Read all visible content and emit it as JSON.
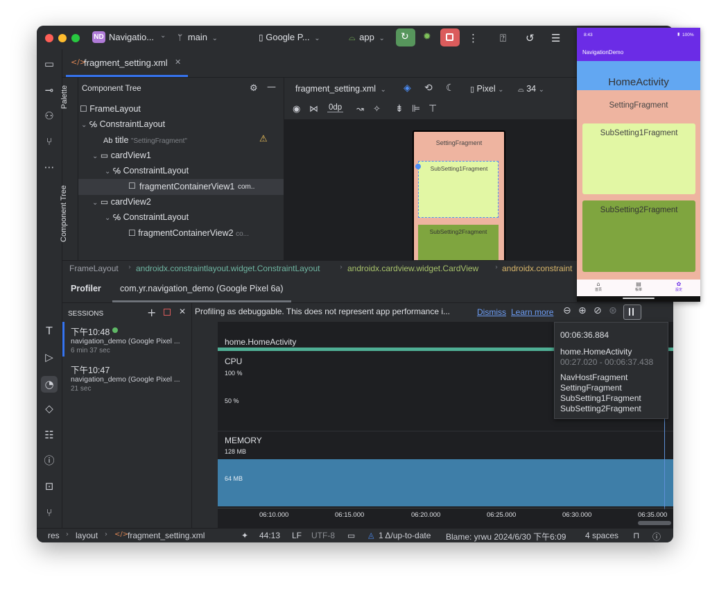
{
  "titlebar": {
    "project_badge": "ND",
    "project_name": "Navigatio...",
    "branch": "main",
    "device": "Google P...",
    "run_config": "app"
  },
  "editor_tab": {
    "label": "fragment_setting.xml"
  },
  "component_tree": {
    "title": "Component Tree",
    "palette_label": "Palette",
    "side_label": "Component Tree",
    "rows": [
      {
        "label": "FrameLayout",
        "suffix": ""
      },
      {
        "label": "ConstraintLayout",
        "suffix": ""
      },
      {
        "label": "title",
        "suffix": "\"SettingFragment\""
      },
      {
        "label": "cardView1",
        "suffix": ""
      },
      {
        "label": "ConstraintLayout",
        "suffix": ""
      },
      {
        "label": "fragmentContainerView1",
        "suffix": "com.."
      },
      {
        "label": "cardView2",
        "suffix": ""
      },
      {
        "label": "ConstraintLayout",
        "suffix": ""
      },
      {
        "label": "fragmentContainerView2",
        "suffix": "co..."
      }
    ],
    "ab_prefix": "Ab"
  },
  "design_toolbar": {
    "file": "fragment_setting.xml",
    "device": "Pixel",
    "api": "34",
    "margin": "0dp"
  },
  "preview": {
    "setting": "SettingFragment",
    "sub1": "SubSetting1Fragment",
    "sub2": "SubSetting2Fragment"
  },
  "breadcrumbs": [
    "FrameLayout",
    "androidx.constraintlayout.widget.ConstraintLayout",
    "androidx.cardview.widget.CardView",
    "androidx.constraint"
  ],
  "profiler": {
    "title": "Profiler",
    "process_tab": "com.yr.navigation_demo (Google Pixel 6a)",
    "sessions_label": "SESSIONS",
    "banner": "Profiling as debuggable. This does not represent app performance i...",
    "dismiss": "Dismiss",
    "learn_more": "Learn more",
    "sessions": [
      {
        "time": "下午10:48",
        "name": "navigation_demo (Google Pixel ...",
        "duration": "6 min 37 sec"
      },
      {
        "time": "下午10:47",
        "name": "navigation_demo (Google Pixel ...",
        "duration": "21 sec"
      }
    ],
    "activity_label": "home.HomeActivity",
    "cpu_label": "CPU",
    "cpu_ticks": [
      "100 %",
      "50 %"
    ],
    "memory_label": "MEMORY",
    "memory_ticks": [
      "128 MB",
      "64 MB"
    ],
    "time_ticks": [
      "06:10.000",
      "06:15.000",
      "06:20.000",
      "06:25.000",
      "06:30.000",
      "06:35.000"
    ],
    "tooltip": {
      "time": "00:06:36.884",
      "activity": "home.HomeActivity",
      "range": "00:27.020 - 00:06:37.438",
      "fragments": [
        "NavHostFragment",
        "SettingFragment",
        "SubSetting1Fragment",
        "SubSetting2Fragment"
      ]
    }
  },
  "statusbar": {
    "path": [
      "res",
      "layout",
      "fragment_setting.xml"
    ],
    "position": "44:13",
    "line_sep": "LF",
    "encoding": "UTF-8",
    "vcs": "1 Δ/up-to-date",
    "blame": "Blame: yrwu 2024/6/30 下午6:09",
    "indent": "4 spaces"
  },
  "phone": {
    "time": "8:43",
    "battery": "100%",
    "app_title": "NavigationDemo",
    "home": "HomeActivity",
    "setting": "SettingFragment",
    "sub1": "SubSetting1Fragment",
    "sub2": "SubSetting2Fragment",
    "nav": [
      "首頁",
      "帳單",
      "設定"
    ]
  },
  "colors": {
    "ide_bg": "#2b2d30",
    "accent": "#3574f0",
    "activity_bar": "#4fae94",
    "memory_fill": "#3e7ea8",
    "salmon": "#eeb4a0",
    "light_green": "#e2f7a4",
    "dark_green": "#7fa53f",
    "phone_purple": "#6b2ce6",
    "phone_blue": "#62a7f2"
  }
}
